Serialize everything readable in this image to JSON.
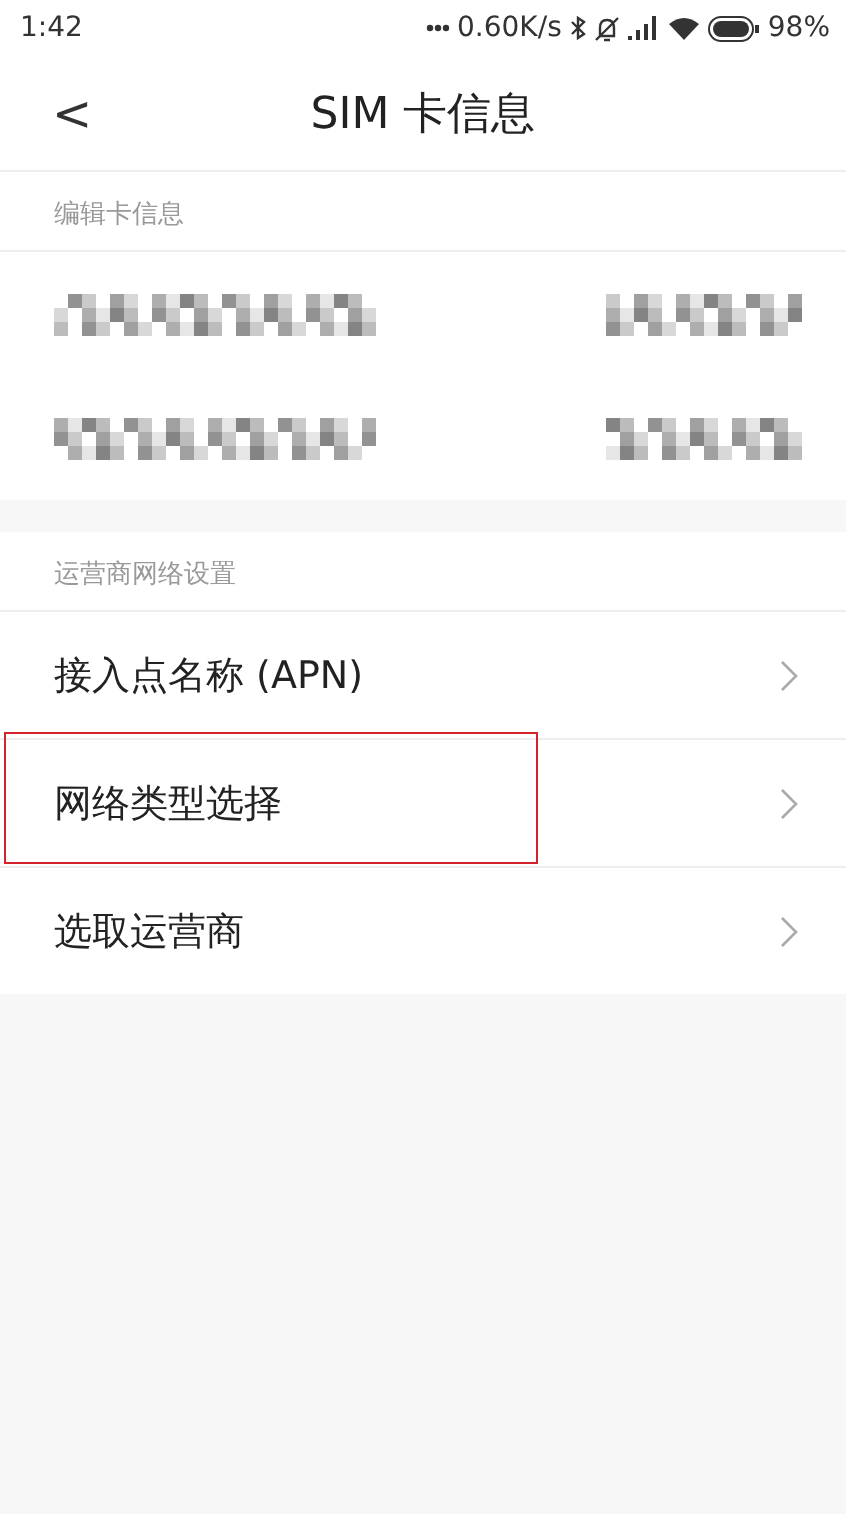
{
  "status_bar": {
    "time": "1:42",
    "speed": "0.60K/s",
    "battery": "98%"
  },
  "header": {
    "back": "<",
    "title": "SIM  卡信息"
  },
  "card_info": {
    "heading": "编辑卡信息",
    "rows": [
      {
        "kind": "mosaic"
      },
      {
        "kind": "mosaic"
      }
    ]
  },
  "network_settings": {
    "heading": "运营商网络设置",
    "items": [
      {
        "label": "接入点名称 (APN)",
        "highlighted": false
      },
      {
        "label": "网络类型选择",
        "highlighted": true
      },
      {
        "label": "选取运营商",
        "highlighted": false
      }
    ]
  }
}
